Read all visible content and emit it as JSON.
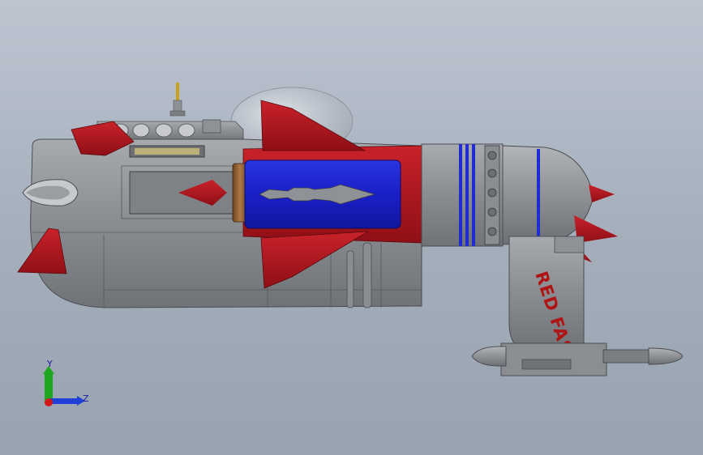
{
  "viewport": {
    "background_top": "#bcc4d0",
    "background_bottom": "#98a3b0"
  },
  "model": {
    "name": "rocket-ship-model",
    "hull_text": "RED FAST",
    "colors": {
      "hull_gray": "#8a8d91",
      "accent_red": "#b3121c",
      "cockpit_blue": "#1a1fc8",
      "stripe_blue": "#1f2cd6",
      "copper": "#8a5a2c",
      "antenna_gold": "#c9a21d"
    }
  },
  "triad": {
    "y_label": "Y",
    "z_label": "Z",
    "colors": {
      "y": "#1fa81f",
      "z": "#1f3fd6",
      "x": "#d01818"
    }
  }
}
